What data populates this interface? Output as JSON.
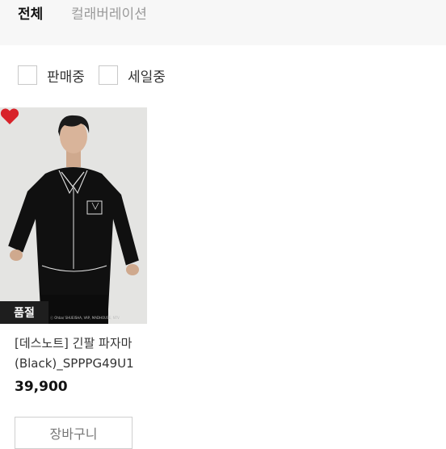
{
  "tabs": [
    {
      "label": "전체",
      "active": true
    },
    {
      "label": "컬래버레이션",
      "active": false
    }
  ],
  "filters": [
    {
      "label": "판매중",
      "checked": false
    },
    {
      "label": "세일중",
      "checked": false
    }
  ],
  "product": {
    "badge": "품절",
    "title_line1": "[데스노트] 긴팔 파자마",
    "title_line2": "(Black)_SPPPG49U1",
    "price": "39,900",
    "wishlisted": true,
    "image_watermark": "ⓒ Ohba/ SHUEISHA, VAP, MADHOUSE, NTV",
    "icons": {
      "wishlist": "heart-icon"
    }
  },
  "actions": {
    "cart_label": "장바구니"
  },
  "colors": {
    "accent_heart": "#d8232a",
    "badge_bg": "#1e1e1e",
    "tab_bar_bg": "#f7f7f7"
  }
}
